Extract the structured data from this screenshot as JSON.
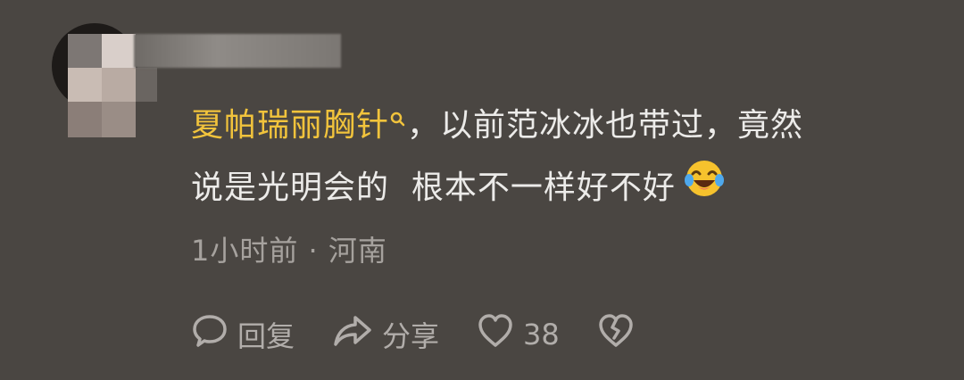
{
  "comment": {
    "mention": "夏帕瑞丽胸针",
    "text_line1": "，以前范冰冰也带过，竟然",
    "text_line2": "说是光明会的  根本不一样好不好"
  },
  "meta": {
    "time": "1小时前",
    "separator": " · ",
    "location": "河南"
  },
  "actions": {
    "reply_label": "回复",
    "share_label": "分享",
    "like_count": "38"
  },
  "icons": {
    "reply": "speech-bubble-icon",
    "share": "share-arrow-icon",
    "like": "heart-icon",
    "dislike": "broken-heart-icon",
    "emoji": "laughing-tears-emoji",
    "mention": "search-link-icon"
  },
  "colors": {
    "background": "#4a4642",
    "mention": "#f1c33c",
    "text": "#ecebe9",
    "meta": "#a6a29e"
  }
}
